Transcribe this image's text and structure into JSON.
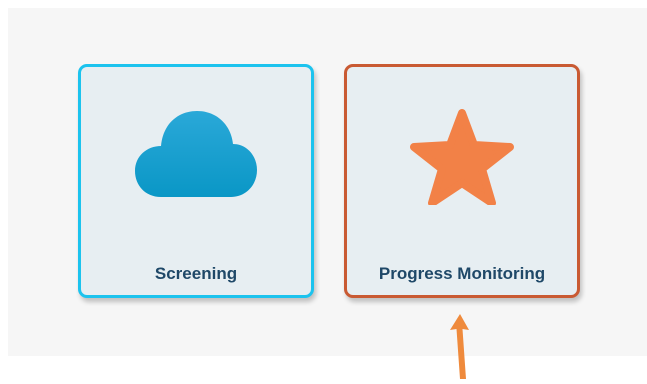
{
  "tiles": [
    {
      "label": "Screening",
      "icon": "cloud-icon",
      "border_color": "#1cc3ee",
      "icon_color": "#0f9bc9"
    },
    {
      "label": "Progress Monitoring",
      "icon": "star-icon",
      "border_color": "#c95a33",
      "icon_color": "#f28147"
    }
  ],
  "annotation": {
    "icon": "arrow-up-icon",
    "color": "#ef8a3c"
  }
}
